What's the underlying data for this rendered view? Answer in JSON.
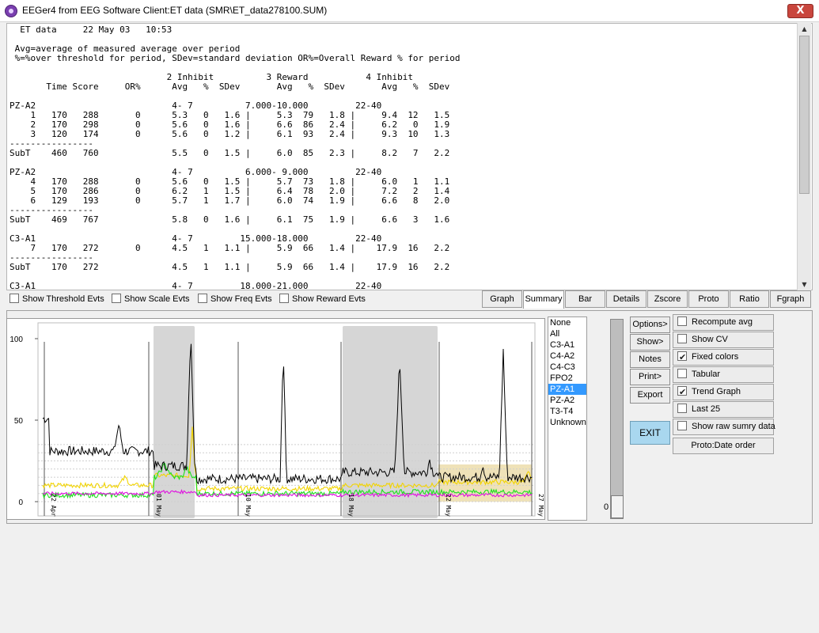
{
  "window": {
    "title": "EEGer4 from EEG Software  Client:ET data  (SMR\\ET_data278100.SUM)",
    "close_label": "X",
    "icon": "eeger-app-icon"
  },
  "report": {
    "lines": [
      "  ET data     22 May 03   10:53",
      "",
      " Avg=average of measured average over period",
      " %=%over threshold for period, SDev=standard deviation OR%=Overall Reward % for period",
      "",
      "                              2 Inhibit          3 Reward           4 Inhibit",
      "       Time Score     OR%      Avg   %  SDev       Avg   %  SDev       Avg   %  SDev",
      "",
      "PZ-A2                          4- 7          7.000-10.000         22-40",
      "    1   170   288       0      5.3   0   1.6 |     5.3  79   1.8 |     9.4  12   1.5",
      "    2   170   298       0      5.6   0   1.6 |     6.6  86   2.4 |     6.2   0   1.9",
      "    3   120   174       0      5.6   0   1.2 |     6.1  93   2.4 |     9.3  10   1.3",
      "----------------",
      "SubT    460   760              5.5   0   1.5 |     6.0  85   2.3 |     8.2   7   2.2",
      "",
      "PZ-A2                          4- 7          6.000- 9.000         22-40",
      "    4   170   288       0      5.6   0   1.5 |     5.7  73   1.8 |     6.0   1   1.1",
      "    5   170   286       0      6.2   1   1.5 |     6.4  78   2.0 |     7.2   2   1.4",
      "    6   129   193       0      5.7   1   1.7 |     6.0  74   1.9 |     6.6   8   2.0",
      "----------------",
      "SubT    469   767              5.8   0   1.6 |     6.1  75   1.9 |     6.6   3   1.6",
      "",
      "C3-A1                          4- 7         15.000-18.000         22-40",
      "    7   170   272       0      4.5   1   1.1 |     5.9  66   1.4 |    17.9  16   2.2",
      "----------------",
      "SubT    170   272              4.5   1   1.1 |     5.9  66   1.4 |    17.9  16   2.2",
      "",
      "C3-A1                          4- 7         18.000-21.000         22-40"
    ]
  },
  "event_options": [
    {
      "label": "Show Threshold Evts",
      "checked": false
    },
    {
      "label": "Show Scale Evts",
      "checked": false
    },
    {
      "label": "Show Freq Evts",
      "checked": false
    },
    {
      "label": "Show Reward Evts",
      "checked": false
    }
  ],
  "tabs": [
    {
      "label": "Graph",
      "active": false
    },
    {
      "label": "Summary",
      "active": true
    },
    {
      "label": "Bar",
      "active": false
    },
    {
      "label": "Details",
      "active": false
    },
    {
      "label": "Zscore",
      "active": false
    },
    {
      "label": "Proto",
      "active": false
    },
    {
      "label": "Ratio",
      "active": false
    },
    {
      "label": "Fgraph",
      "active": false
    }
  ],
  "graph": {
    "y_ticks": [
      "100",
      "50",
      "0"
    ],
    "x_labels": [
      "22 Apr 03",
      "01 May 03",
      "10 May 03",
      "18 May 03",
      "22 May 03",
      "27 May 03"
    ],
    "colors": {
      "black": "#000000",
      "yellow": "#f2d400",
      "green": "#1ee01e",
      "magenta": "#e010e0",
      "shade_gray": "#d6d6d6",
      "shade_tan": "#efe2b8",
      "grid": "#cfcfcf"
    }
  },
  "sites": {
    "items": [
      "None",
      "All",
      "C3-A1",
      "C4-A2",
      "C4-C3",
      "FPO2",
      "PZ-A1",
      "PZ-A2",
      "T3-T4",
      "Unknown"
    ],
    "selected": "PZ-A1"
  },
  "slider": {
    "value": "0"
  },
  "buttons": {
    "options": "Options>",
    "show": "Show>",
    "notes": "Notes",
    "print": "Print>",
    "export": "Export",
    "exit": "EXIT"
  },
  "graph_options": [
    {
      "label": "Recompute avg",
      "checked": false
    },
    {
      "label": "Show CV",
      "checked": false
    },
    {
      "label": "Fixed colors",
      "checked": true
    },
    {
      "label": "Tabular",
      "checked": false
    },
    {
      "label": "Trend Graph",
      "checked": true
    },
    {
      "label": "Last 25",
      "checked": false
    },
    {
      "label": "Show raw sumry data",
      "checked": false
    }
  ],
  "proto_order_label": "Proto:Date order"
}
